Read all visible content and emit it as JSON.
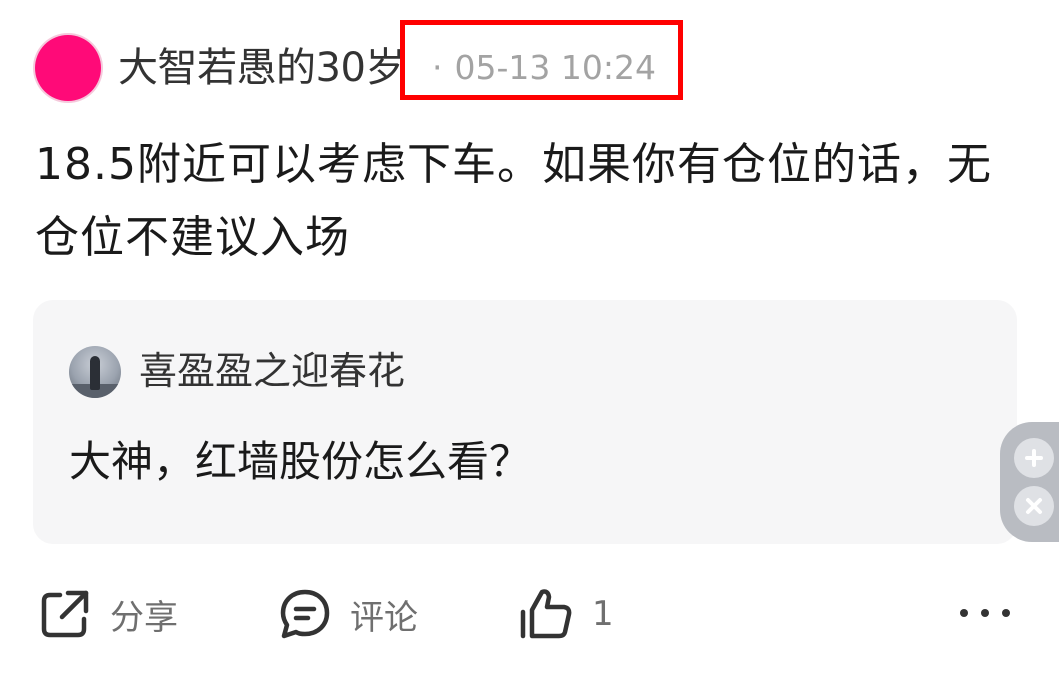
{
  "post": {
    "author": "大智若愚的30岁",
    "separator": "·",
    "timestamp": "05-13 10:24",
    "content": "18.5附近可以考虑下车。如果你有仓位的话，无仓位不建议入场"
  },
  "quote": {
    "author": "喜盈盈之迎春花",
    "content": "大神，红墙股份怎么看？"
  },
  "actions": {
    "share_label": "分享",
    "comment_label": "评论",
    "like_count": "1"
  },
  "icons": {
    "share": "share-icon",
    "comment": "comment-icon",
    "like": "thumbs-up-icon",
    "more": "more-icon",
    "plus": "plus-icon",
    "close": "close-icon"
  },
  "colors": {
    "avatar": "#ff0a78",
    "highlight_box": "#ff0000",
    "card_background": "#f6f6f7"
  }
}
